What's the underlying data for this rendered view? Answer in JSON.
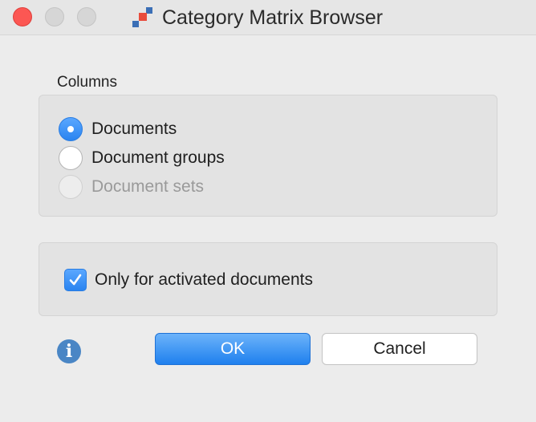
{
  "window": {
    "title": "Category Matrix Browser"
  },
  "columns": {
    "label": "Columns",
    "options": [
      {
        "label": "Documents",
        "state": "selected"
      },
      {
        "label": "Document groups",
        "state": "unselected"
      },
      {
        "label": "Document sets",
        "state": "disabled"
      }
    ]
  },
  "options": {
    "only_activated_label": "Only for activated documents",
    "only_activated_checked": true
  },
  "buttons": {
    "ok_label": "OK",
    "cancel_label": "Cancel"
  },
  "icons": {
    "info": "i"
  },
  "colors": {
    "accent": "#2a84f0",
    "close": "#fc5753",
    "info": "#4a86c5"
  }
}
